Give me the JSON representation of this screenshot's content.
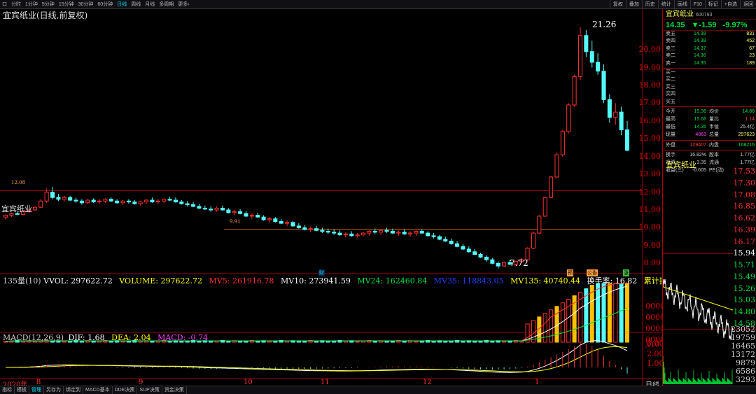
{
  "toolbar": {
    "left": [
      "口",
      "分时",
      "1分钟",
      "5分钟",
      "15分钟",
      "30分钟",
      "60分钟",
      "日线",
      "周线",
      "月线",
      "多周期",
      "更多›"
    ],
    "active": "日线",
    "right": [
      "复权",
      "叠加",
      "历史",
      "统计",
      "画线",
      "F10",
      "标记",
      "+自选",
      "返回"
    ]
  },
  "chart": {
    "title": "宜宾纸业(日线,前复权)",
    "side_label": "宜宾纸业",
    "marker_high": "21.26",
    "marker_low": "7.72",
    "ref_line_1": "12.08",
    "ref_line_2": "9.91",
    "y_labels": [
      "20.00",
      "19.00",
      "18.00",
      "17.00",
      "16.00",
      "15.00",
      "14.00",
      "13.00",
      "12.00",
      "11.00",
      "10.00",
      "9.00",
      "8.00"
    ],
    "vol_bar_label": "135量(10)",
    "vvol": "VVOL: 297622.72",
    "volume": "VOLUME: 297622.72",
    "mv5": "MV5: 261916.78",
    "mv10": "MV10: 273941.59",
    "mv24": "MV24: 162460.84",
    "mv35": "MV35: 118843.05",
    "mv135": "MV135: 40740.44",
    "turnover": "换手率: 16.82",
    "cum_turnover": "累计换手:",
    "vol_y": [
      "0000",
      "0000",
      "0000",
      "0000",
      "X10"
    ],
    "macd_label": "MACD(12,26,9)",
    "dif": "DIF: 1.68",
    "dea": "DEA: 2.04",
    "macd": "MACD: -0.74",
    "macd_y": [
      "3.00",
      "2.00",
      "1.00"
    ],
    "x_labels": [
      "2020年",
      "8",
      "9",
      "10",
      "11",
      "12",
      "1",
      "日线"
    ],
    "marks": [
      "财",
      "预",
      "公告",
      "涨"
    ]
  },
  "chart_data": {
    "type": "candlestick",
    "title": "宜宾纸业(日线,前复权)",
    "ylim": [
      7.5,
      21.5
    ],
    "candles": [
      [
        10.6,
        10.75,
        10.45,
        10.7
      ],
      [
        10.7,
        10.85,
        10.6,
        10.8
      ],
      [
        10.8,
        10.9,
        10.7,
        10.75
      ],
      [
        10.75,
        11.0,
        10.7,
        10.95
      ],
      [
        10.95,
        11.1,
        10.85,
        11.0
      ],
      [
        11.0,
        11.2,
        10.95,
        11.15
      ],
      [
        11.15,
        11.6,
        11.1,
        11.5
      ],
      [
        11.5,
        12.2,
        11.4,
        12.0
      ],
      [
        12.0,
        12.3,
        11.6,
        11.7
      ],
      [
        11.7,
        11.9,
        11.5,
        11.6
      ],
      [
        11.6,
        11.8,
        11.45,
        11.7
      ],
      [
        11.7,
        11.8,
        11.5,
        11.55
      ],
      [
        11.55,
        11.7,
        11.4,
        11.5
      ],
      [
        11.5,
        11.6,
        11.3,
        11.4
      ],
      [
        11.4,
        11.6,
        11.35,
        11.55
      ],
      [
        11.55,
        11.65,
        11.4,
        11.45
      ],
      [
        11.45,
        11.6,
        11.35,
        11.5
      ],
      [
        11.5,
        11.65,
        11.4,
        11.6
      ],
      [
        11.6,
        11.7,
        11.45,
        11.5
      ],
      [
        11.5,
        11.6,
        11.35,
        11.4
      ],
      [
        11.4,
        11.55,
        11.3,
        11.5
      ],
      [
        11.5,
        11.6,
        11.35,
        11.45
      ],
      [
        11.45,
        11.55,
        11.3,
        11.35
      ],
      [
        11.35,
        11.5,
        11.25,
        11.45
      ],
      [
        11.45,
        11.6,
        11.35,
        11.55
      ],
      [
        11.55,
        11.7,
        11.4,
        11.45
      ],
      [
        11.45,
        11.6,
        11.35,
        11.5
      ],
      [
        11.5,
        11.65,
        11.4,
        11.6
      ],
      [
        11.6,
        11.75,
        11.5,
        11.55
      ],
      [
        11.55,
        11.7,
        11.4,
        11.45
      ],
      [
        11.45,
        11.55,
        11.3,
        11.35
      ],
      [
        11.35,
        11.5,
        11.2,
        11.3
      ],
      [
        11.3,
        11.45,
        11.15,
        11.2
      ],
      [
        11.2,
        11.35,
        11.05,
        11.1
      ],
      [
        11.1,
        11.25,
        11.0,
        11.05
      ],
      [
        11.05,
        11.2,
        10.9,
        11.0
      ],
      [
        11.0,
        11.2,
        10.9,
        11.1
      ],
      [
        11.1,
        11.25,
        10.95,
        11.0
      ],
      [
        11.0,
        11.1,
        10.8,
        10.85
      ],
      [
        10.85,
        11.0,
        10.7,
        10.9
      ],
      [
        10.9,
        11.05,
        10.75,
        10.8
      ],
      [
        10.8,
        10.95,
        10.6,
        10.65
      ],
      [
        10.65,
        10.8,
        10.5,
        10.7
      ],
      [
        10.7,
        10.85,
        10.55,
        10.6
      ],
      [
        10.6,
        10.7,
        10.4,
        10.45
      ],
      [
        10.45,
        10.6,
        10.3,
        10.5
      ],
      [
        10.5,
        10.6,
        10.3,
        10.35
      ],
      [
        10.35,
        10.5,
        10.2,
        10.25
      ],
      [
        10.25,
        10.4,
        10.1,
        10.3
      ],
      [
        10.3,
        10.4,
        10.05,
        10.1
      ],
      [
        10.1,
        10.25,
        9.95,
        10.0
      ],
      [
        10.0,
        10.15,
        9.85,
        9.9
      ],
      [
        9.9,
        10.05,
        9.75,
        9.95
      ],
      [
        9.95,
        10.1,
        9.8,
        9.85
      ],
      [
        9.85,
        10.0,
        9.7,
        9.8
      ],
      [
        9.8,
        9.95,
        9.65,
        9.75
      ],
      [
        9.75,
        9.9,
        9.6,
        9.7
      ],
      [
        9.7,
        9.85,
        9.55,
        9.6
      ],
      [
        9.6,
        9.75,
        9.45,
        9.65
      ],
      [
        9.65,
        9.8,
        9.5,
        9.55
      ],
      [
        9.55,
        9.7,
        9.45,
        9.6
      ],
      [
        9.6,
        9.75,
        9.5,
        9.7
      ],
      [
        9.7,
        9.85,
        9.55,
        9.8
      ],
      [
        9.8,
        9.95,
        9.65,
        9.75
      ],
      [
        9.75,
        9.9,
        9.6,
        9.85
      ],
      [
        9.85,
        10.0,
        9.7,
        9.8
      ],
      [
        9.8,
        9.95,
        9.65,
        9.7
      ],
      [
        9.7,
        9.85,
        9.55,
        9.75
      ],
      [
        9.75,
        9.9,
        9.6,
        9.65
      ],
      [
        9.65,
        9.8,
        9.5,
        9.7
      ],
      [
        9.7,
        9.85,
        9.55,
        9.8
      ],
      [
        9.8,
        9.9,
        9.65,
        9.7
      ],
      [
        9.7,
        9.8,
        9.5,
        9.55
      ],
      [
        9.55,
        9.7,
        9.4,
        9.5
      ],
      [
        9.5,
        9.6,
        9.3,
        9.35
      ],
      [
        9.35,
        9.5,
        9.2,
        9.25
      ],
      [
        9.25,
        9.4,
        9.05,
        9.1
      ],
      [
        9.1,
        9.25,
        8.9,
        8.95
      ],
      [
        8.95,
        9.1,
        8.75,
        8.8
      ],
      [
        8.8,
        8.95,
        8.6,
        8.65
      ],
      [
        8.65,
        8.8,
        8.45,
        8.5
      ],
      [
        8.5,
        8.6,
        8.3,
        8.35
      ],
      [
        8.35,
        8.45,
        8.1,
        8.2
      ],
      [
        8.2,
        8.3,
        7.95,
        8.0
      ],
      [
        8.0,
        8.1,
        7.72,
        7.85
      ],
      [
        7.85,
        8.1,
        7.8,
        8.05
      ],
      [
        8.05,
        8.2,
        7.9,
        7.95
      ],
      [
        7.95,
        8.15,
        7.9,
        8.1
      ],
      [
        8.1,
        8.3,
        8.0,
        8.2
      ],
      [
        8.2,
        8.9,
        8.15,
        8.85
      ],
      [
        8.85,
        9.8,
        8.8,
        9.7
      ],
      [
        9.7,
        10.7,
        9.65,
        10.65
      ],
      [
        10.65,
        11.75,
        10.6,
        11.7
      ],
      [
        11.7,
        12.9,
        11.65,
        12.85
      ],
      [
        12.85,
        14.2,
        12.8,
        14.1
      ],
      [
        14.1,
        15.5,
        14.0,
        15.4
      ],
      [
        15.4,
        17.0,
        15.3,
        16.9
      ],
      [
        16.9,
        18.6,
        16.8,
        18.5
      ],
      [
        18.5,
        21.26,
        18.3,
        20.8
      ],
      [
        20.8,
        21.1,
        19.6,
        19.9
      ],
      [
        19.9,
        20.5,
        19.0,
        19.3
      ],
      [
        19.3,
        19.8,
        18.6,
        18.8
      ],
      [
        18.8,
        19.2,
        17.0,
        17.2
      ],
      [
        17.2,
        17.5,
        15.9,
        16.2
      ],
      [
        16.2,
        17.0,
        15.8,
        16.5
      ],
      [
        16.5,
        16.8,
        15.2,
        15.5
      ],
      [
        15.5,
        16.0,
        14.3,
        14.35
      ]
    ],
    "volume_series": [
      "VVOL",
      "VOLUME",
      "MV5",
      "MV10",
      "MV24",
      "MV35",
      "MV135"
    ],
    "macd_series": [
      "DIF",
      "DEA",
      "MACD"
    ]
  },
  "panel": {
    "name": "宜宾纸业",
    "code": "600793",
    "price": "14.35",
    "change": "▼-1.59",
    "change_pct": "-9.97%",
    "asks": [
      {
        "label": "卖五",
        "price": "14.39",
        "vol": "831"
      },
      {
        "label": "卖四",
        "price": "14.38",
        "vol": "452"
      },
      {
        "label": "卖三",
        "price": "14.37",
        "vol": "67"
      },
      {
        "label": "卖二",
        "price": "14.36",
        "vol": "23"
      },
      {
        "label": "卖一",
        "price": "14.35",
        "vol": "189"
      }
    ],
    "bids": [
      {
        "label": "买一",
        "price": "",
        "vol": ""
      },
      {
        "label": "买二",
        "price": "",
        "vol": ""
      },
      {
        "label": "买三",
        "price": "",
        "vol": ""
      },
      {
        "label": "买四",
        "price": "",
        "vol": ""
      },
      {
        "label": "买五",
        "price": "",
        "vol": ""
      }
    ],
    "stats": [
      {
        "k1": "今开",
        "v1": "15.36",
        "c1": "#00e040",
        "k2": "均价",
        "v2": "14.88",
        "c2": "#00e040"
      },
      {
        "k1": "最高",
        "v1": "15.66",
        "c1": "#00e040",
        "k2": "量比",
        "v2": "1.14",
        "c2": "#ff4040"
      },
      {
        "k1": "最低",
        "v1": "14.35",
        "c1": "#00e040",
        "k2": "市值",
        "v2": "25.4亿",
        "c2": "#ccc"
      },
      {
        "k1": "现量",
        "v1": "4863",
        "c1": "#ff40ff",
        "k2": "总量",
        "v2": "297623",
        "c2": "#ffff60"
      },
      {
        "k1": "外盘",
        "v1": "129407",
        "c1": "#ff4040",
        "k2": "内盘",
        "v2": "168216",
        "c2": "#00e040"
      },
      {
        "k1": "换手",
        "v1": "16.82%",
        "c1": "#ccc",
        "k2": "股本",
        "v2": "1.77亿",
        "c2": "#ccc"
      },
      {
        "k1": "净资",
        "v1": "3.35",
        "c1": "#ccc",
        "k2": "流通",
        "v2": "1.77亿",
        "c2": "#ccc"
      },
      {
        "k1": "收益(三)",
        "v1": "-0.605",
        "c1": "#ccc",
        "k2": "PE(动)",
        "v2": "--",
        "c2": "#ccc"
      }
    ],
    "mini_title": "宜宾纸业",
    "mini_price_labels": [
      "17.53",
      "17.30",
      "17.08",
      "16.85",
      "16.62",
      "16.39",
      "16.17",
      "15.94",
      "15.71",
      "15.49",
      "15.26",
      "15.03",
      "14.80",
      "14.58"
    ],
    "mini_vol_labels": [
      "23052",
      "19759",
      "16465",
      "13172",
      "9879",
      "6586",
      "3293"
    ]
  },
  "bottombar": {
    "items": [
      "指标",
      "模板",
      "管理",
      "另存为",
      "绑定到",
      "MACD基本",
      "DDE决策",
      "SUP决策",
      "资金决策"
    ],
    "active": "管理"
  },
  "colors": {
    "up": "#ff3030",
    "down": "#54fcfc",
    "grid": "#a00000",
    "yellow": "#ffff00",
    "white": "#ffffff",
    "green": "#00e040",
    "blue": "#2040ff",
    "magenta": "#ff40ff"
  }
}
